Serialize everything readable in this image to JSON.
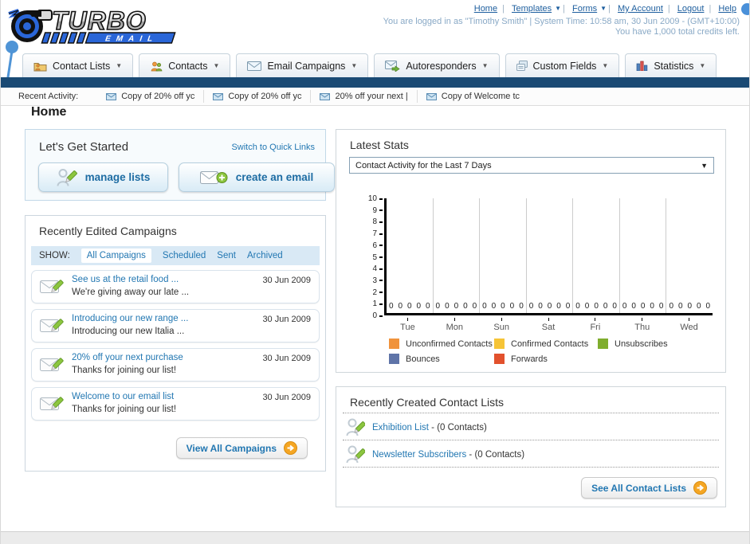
{
  "icons": {
    "caret_down": "▼",
    "pipe": "|"
  },
  "header": {
    "logo_title": "TURBO",
    "logo_subtitle": "EMAIL",
    "nav_links": [
      "Home",
      "Templates",
      "Forms",
      "My Account",
      "Logout",
      "Help"
    ],
    "status_line1": "You are logged in as \"Timothy Smith\" | System Time: 10:58 am, 30 Jun 2009 - (GMT+10:00)",
    "status_line2": "You have 1,000 total credits left."
  },
  "tabs": [
    {
      "label": "Contact Lists"
    },
    {
      "label": "Contacts"
    },
    {
      "label": "Email Campaigns"
    },
    {
      "label": "Autoresponders"
    },
    {
      "label": "Custom Fields"
    },
    {
      "label": "Statistics"
    }
  ],
  "recent_activity": {
    "label": "Recent Activity:",
    "items": [
      "Copy of 20% off yc",
      "Copy of 20% off yc",
      "20% off your next |",
      "Copy of Welcome tc"
    ]
  },
  "page_title": "Home",
  "get_started": {
    "title": "Let's Get Started",
    "switch_link": "Switch to Quick Links",
    "manage_lists_label": "manage lists",
    "create_email_label": "create an email"
  },
  "campaigns": {
    "title": "Recently Edited Campaigns",
    "show_label": "SHOW:",
    "filters": [
      "All Campaigns",
      "Scheduled",
      "Sent",
      "Archived"
    ],
    "active_filter": "All Campaigns",
    "items": [
      {
        "title": "See us at the retail food ...",
        "subtitle": "We're giving away our late ...",
        "date": "30 Jun 2009"
      },
      {
        "title": "Introducing our new range ...",
        "subtitle": "Introducing our new Italia ...",
        "date": "30 Jun 2009"
      },
      {
        "title": "20% off your next purchase",
        "subtitle": "Thanks for joining our list!",
        "date": "30 Jun 2009"
      },
      {
        "title": "Welcome to our email list",
        "subtitle": "Thanks for joining our list!",
        "date": "30 Jun 2009"
      }
    ],
    "view_all_label": "View All Campaigns"
  },
  "latest_stats": {
    "title": "Latest Stats",
    "dropdown_value": "Contact Activity for the Last 7 Days"
  },
  "chart_data": {
    "type": "bar",
    "title": "Contact Activity for the Last 7 Days",
    "xlabel": "",
    "ylabel": "",
    "ylim": [
      0,
      10
    ],
    "yticks": [
      "10",
      "9",
      "8",
      "7",
      "6",
      "5",
      "4",
      "3",
      "2",
      "1",
      "0"
    ],
    "categories": [
      "Tue",
      "Mon",
      "Sun",
      "Sat",
      "Fri",
      "Thu",
      "Wed"
    ],
    "legend_position": "bottom",
    "grid": "vertical",
    "series": [
      {
        "name": "Unconfirmed Contacts",
        "color": "#f0933c",
        "values": [
          0,
          0,
          0,
          0,
          0,
          0,
          0
        ]
      },
      {
        "name": "Confirmed Contacts",
        "color": "#f6c437",
        "values": [
          0,
          0,
          0,
          0,
          0,
          0,
          0
        ]
      },
      {
        "name": "Unsubscribes",
        "color": "#7fad2e",
        "values": [
          0,
          0,
          0,
          0,
          0,
          0,
          0
        ]
      },
      {
        "name": "Bounces",
        "color": "#5f74a8",
        "values": [
          0,
          0,
          0,
          0,
          0,
          0,
          0
        ]
      },
      {
        "name": "Forwards",
        "color": "#e2512d",
        "values": [
          0,
          0,
          0,
          0,
          0,
          0,
          0
        ]
      }
    ]
  },
  "contact_lists": {
    "title": "Recently Created Contact Lists",
    "items": [
      {
        "name": "Exhibition List",
        "suffix": " - (0 Contacts)"
      },
      {
        "name": "Newsletter Subscribers",
        "suffix": " - (0 Contacts)"
      }
    ],
    "see_all_label": "See All Contact Lists"
  }
}
